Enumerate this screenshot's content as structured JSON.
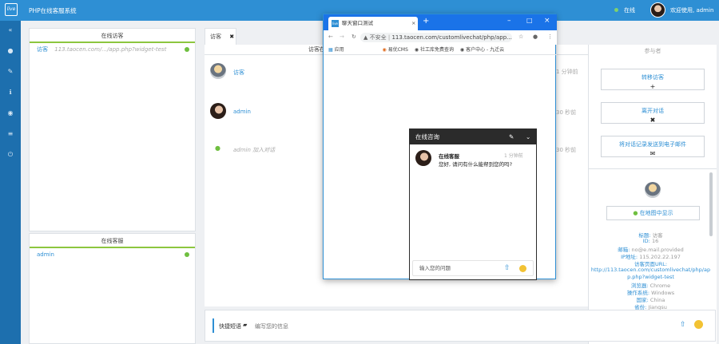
{
  "app": {
    "logo": "live",
    "title": "PHP在线客服系统",
    "status": "在线",
    "welcome": "欢迎使用, admin"
  },
  "visitors_panel": {
    "title": "在线访客",
    "items": [
      {
        "name": "访客",
        "url": "113.taocen.com/.../app.php?widget-test"
      }
    ]
  },
  "agents_panel": {
    "title": "在线客服",
    "items": [
      {
        "name": "admin"
      }
    ]
  },
  "tabs": [
    {
      "label": "访客",
      "close": "✖"
    }
  ],
  "chat_header": "访客在",
  "chat": {
    "messages": [
      {
        "name": "访客",
        "time": "1 分钟前"
      },
      {
        "name": "admin",
        "time": "30 秒前"
      },
      {
        "name": "admin 加入对话",
        "time": "30 秒前"
      }
    ]
  },
  "right": {
    "header": "参与者",
    "buttons": [
      {
        "label": "转移访客",
        "icon": "+"
      },
      {
        "label": "离开对话",
        "icon": "✖"
      },
      {
        "label": "将对话记录发送到电子邮件",
        "icon": "✉"
      }
    ],
    "map_button": "在地图中显示",
    "info": {
      "title_label": "标题:",
      "title": "访客",
      "id_label": "ID:",
      "id": "16",
      "email_label": "邮箱:",
      "email": "no@e.mail.provided",
      "ip_label": "IP地址:",
      "ip": "115.202.22.197",
      "url_label": "访客页面URL:",
      "url": "http://113.taocen.com/customlivechat/php/app.php?widget-test",
      "browser_label": "浏览器:",
      "browser": "Chrome",
      "os_label": "操作系统:",
      "os": "Windows",
      "country_label": "国家:",
      "country": "China",
      "city_label": "省份:",
      "city": "Jiangsu"
    }
  },
  "bottom": {
    "quick_label": "快捷短语",
    "placeholder": "编写您的信息"
  },
  "popup": {
    "tab_title": "聊天窗口测试",
    "url_prefix": "不安全",
    "url": "113.taocen.com/customlivechat/php/app....",
    "bookmarks": [
      "应用",
      "易优CMS",
      "社工库免费查询",
      "客户中心 - 九迁云"
    ],
    "widget": {
      "title": "在线咨询",
      "agent_name": "在线客服",
      "time": "1 分钟前",
      "message": "您好, 请问有什么能帮到您的吗?",
      "input_placeholder": "输入您的问题"
    }
  },
  "colors": {
    "topbar": "#2e8fd4",
    "sidebar": "#1d6fae",
    "accent_green": "#8cc63f",
    "widget_dark": "#2b2b2b"
  }
}
